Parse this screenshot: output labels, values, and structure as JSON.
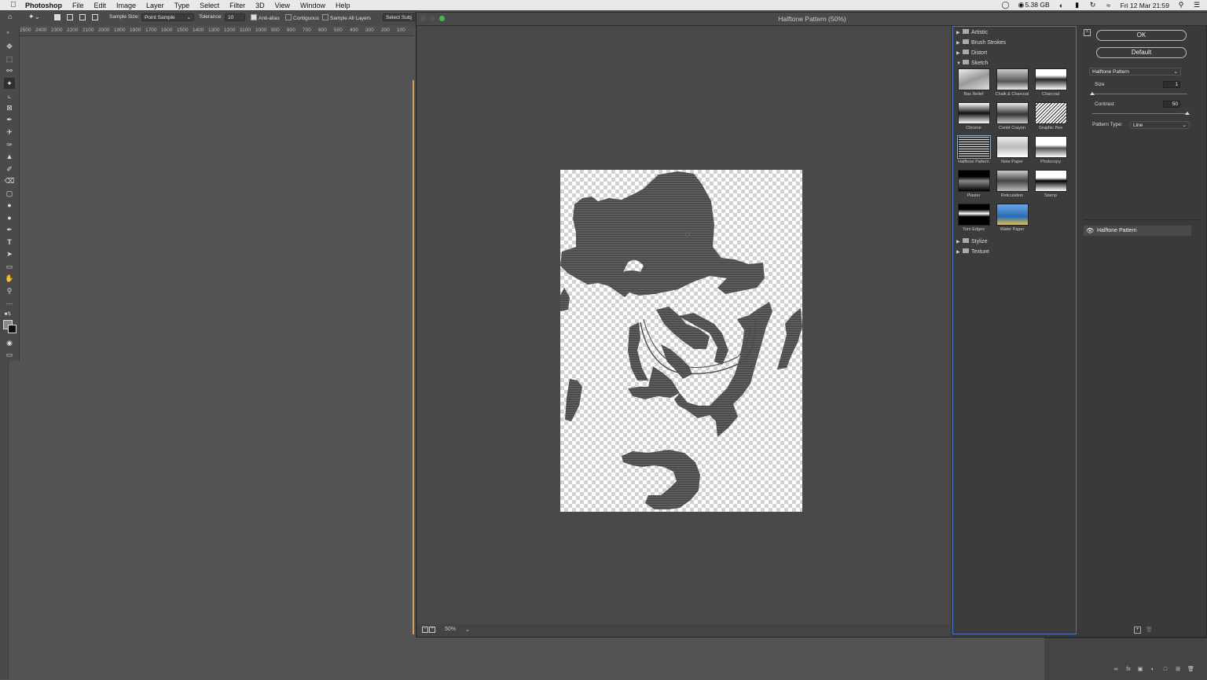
{
  "menubar": {
    "app": "Photoshop",
    "items": [
      "File",
      "Edit",
      "Image",
      "Layer",
      "Type",
      "Select",
      "Filter",
      "3D",
      "View",
      "Window",
      "Help"
    ],
    "memory": "5.38 GB",
    "datetime": "Fri 12 Mar  21:59"
  },
  "options": {
    "sample_size_label": "Sample Size:",
    "sample_size_value": "Point Sample",
    "tolerance_label": "Tolerance:",
    "tolerance_value": "10",
    "anti_alias": "Anti-alias",
    "contiguous": "Contiguous",
    "sample_all_layers": "Sample All Layers",
    "select_subject": "Select Subj"
  },
  "ruler": [
    "2500",
    "2400",
    "2300",
    "2200",
    "2100",
    "2000",
    "1900",
    "1800",
    "1700",
    "1600",
    "1500",
    "1400",
    "1300",
    "1200",
    "1100",
    "1000",
    "900",
    "800",
    "700",
    "600",
    "500",
    "400",
    "300",
    "200",
    "100"
  ],
  "dialog": {
    "title": "Halftone Pattern (50%)",
    "zoom": "50%",
    "categories_top": [
      "Artistic",
      "Brush Strokes",
      "Distort"
    ],
    "open_category": "Sketch",
    "categories_bottom": [
      "Stylize",
      "Texture"
    ],
    "filters": [
      "Bas Relief",
      "Chalk & Charcoal",
      "Charcoal",
      "Chrome",
      "Conté Crayon",
      "Graphic Pen",
      "Halftone Pattern",
      "Note Paper",
      "Photocopy",
      "Plaster",
      "Reticulation",
      "Stamp",
      "Torn Edges",
      "Water Paper"
    ],
    "ok_label": "OK",
    "default_label": "Default",
    "filter_select": "Halftone Pattern",
    "size_label": "Size",
    "size_value": "1",
    "size_level": 0.0,
    "contrast_label": "Contrast",
    "contrast_value": "50",
    "contrast_level": 1.0,
    "pattern_type_label": "Pattern Type:",
    "pattern_type_value": "Line",
    "effect_layer": "Halftone Pattern"
  },
  "colors": {
    "accent_border": "#4a75c9",
    "ruler_guide": "#c8a25b",
    "canvas_bg": "#494949"
  }
}
